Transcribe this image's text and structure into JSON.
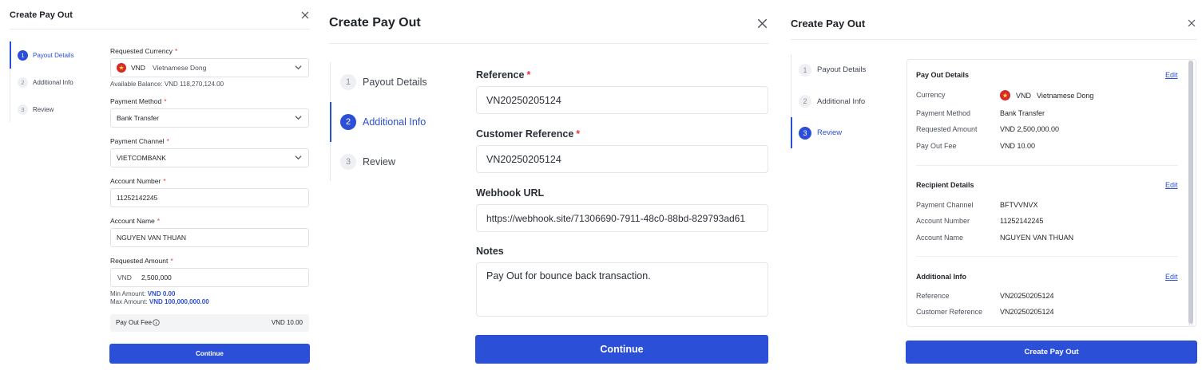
{
  "title": "Create Pay Out",
  "steps": [
    "Payout Details",
    "Additional Info",
    "Review"
  ],
  "step_numbers": [
    "1",
    "2",
    "3"
  ],
  "required_mark": "*",
  "colors": {
    "primary": "#2b4fd6",
    "required": "#e23b3b",
    "flag_red": "#d42a2a",
    "flag_star": "#ffd33d"
  },
  "icons": {
    "close": "close-icon",
    "chevron": "chevron-down-icon",
    "flag": "vietnam-flag-icon",
    "info": "info-circle-icon"
  },
  "payout_details": {
    "currency_label": "Requested Currency",
    "currency_code": "VND",
    "currency_name": "Vietnamese Dong",
    "available_balance": "Available Balance: VND 118,270,124.00",
    "method_label": "Payment Method",
    "method_value": "Bank Transfer",
    "channel_label": "Payment Channel",
    "channel_value": "VIETCOMBANK",
    "account_number_label": "Account Number",
    "account_number_value": "11252142245",
    "account_name_label": "Account Name",
    "account_name_value": "NGUYEN VAN THUAN",
    "amount_label": "Requested Amount",
    "amount_currency": "VND",
    "amount_value": "2,500,000",
    "min_label": "Min Amount:",
    "min_value": "VND 0.00",
    "max_label": "Max Amount:",
    "max_value": "VND 100,000,000.00",
    "fee_label": "Pay Out Fee",
    "fee_value": "VND 10.00",
    "continue": "Continue"
  },
  "additional_info": {
    "reference_label": "Reference",
    "reference_value": "VN20250205124",
    "customer_reference_label": "Customer Reference",
    "customer_reference_value": "VN20250205124",
    "webhook_label": "Webhook URL",
    "webhook_value": "https://webhook.site/71306690-7911-48c0-88bd-829793ad61",
    "notes_label": "Notes",
    "notes_value": "Pay Out for bounce back transaction.",
    "continue": "Continue"
  },
  "review": {
    "edit": "Edit",
    "payout_section": "Pay Out Details",
    "currency_key": "Currency",
    "currency_code": "VND",
    "currency_name": "Vietnamese Dong",
    "method_key": "Payment Method",
    "method_value": "Bank Transfer",
    "amount_key": "Requested Amount",
    "amount_value": "VND 2,500,000.00",
    "fee_key": "Pay Out Fee",
    "fee_value": "VND 10.00",
    "recipient_section": "Recipient Details",
    "channel_key": "Payment Channel",
    "channel_value": "BFTVVNVX",
    "account_number_key": "Account Number",
    "account_number_value": "11252142245",
    "account_name_key": "Account Name",
    "account_name_value": "NGUYEN VAN THUAN",
    "additional_section": "Additional Info",
    "reference_key": "Reference",
    "reference_value": "VN20250205124",
    "customer_reference_key": "Customer Reference",
    "customer_reference_value": "VN20250205124",
    "submit": "Create Pay Out"
  }
}
